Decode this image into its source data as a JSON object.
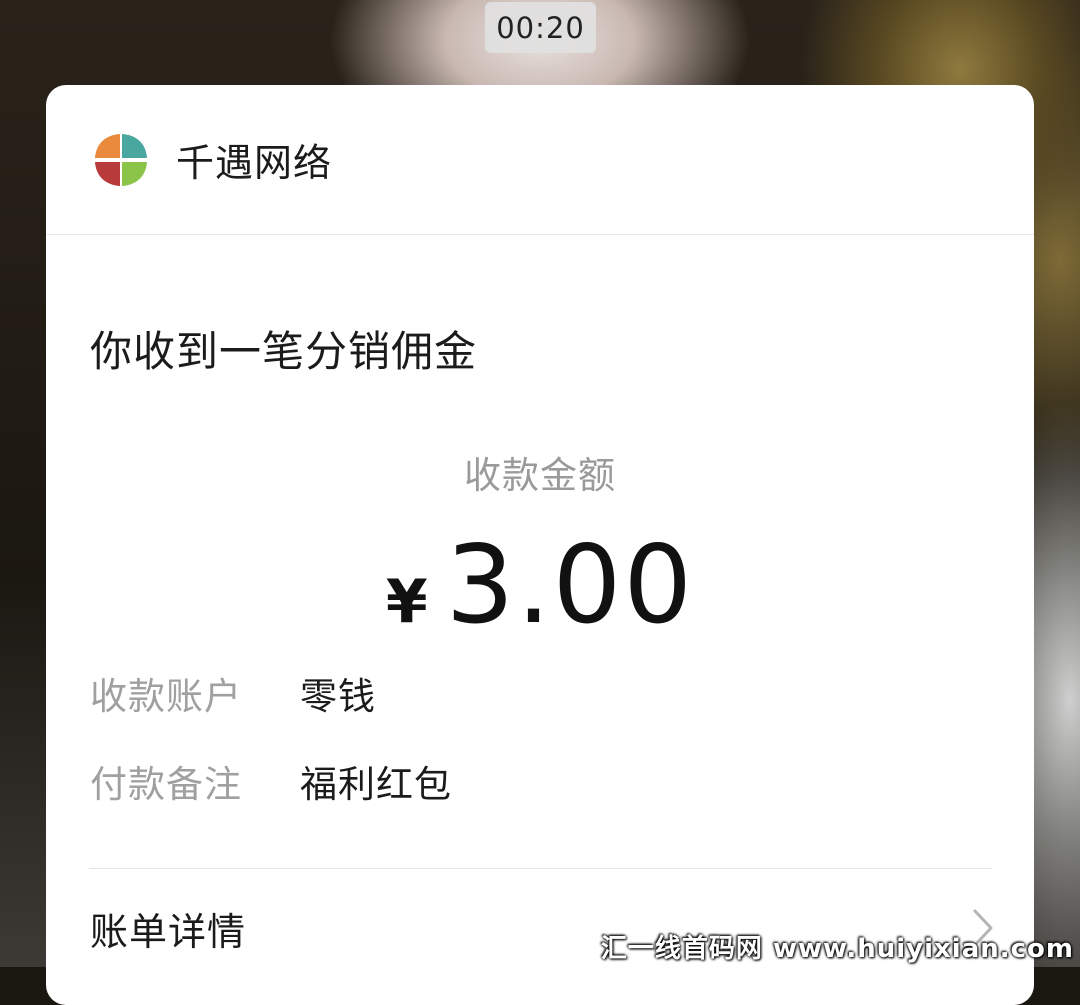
{
  "overlay": {
    "timer": "00:20"
  },
  "card": {
    "org_name": "千遇网络",
    "logo_icon": "quadrant-logo-icon",
    "title": "你收到一笔分销佣金",
    "amount_label": "收款金额",
    "currency_symbol": "¥",
    "amount_value": "3.00",
    "details": [
      {
        "label": "收款账户",
        "value": "零钱"
      },
      {
        "label": "付款备注",
        "value": "福利红包"
      }
    ],
    "bill_detail_label": "账单详情",
    "bill_detail_icon": "chevron-right-icon"
  },
  "watermark": "汇一线首码网 www.huiyixian.com"
}
